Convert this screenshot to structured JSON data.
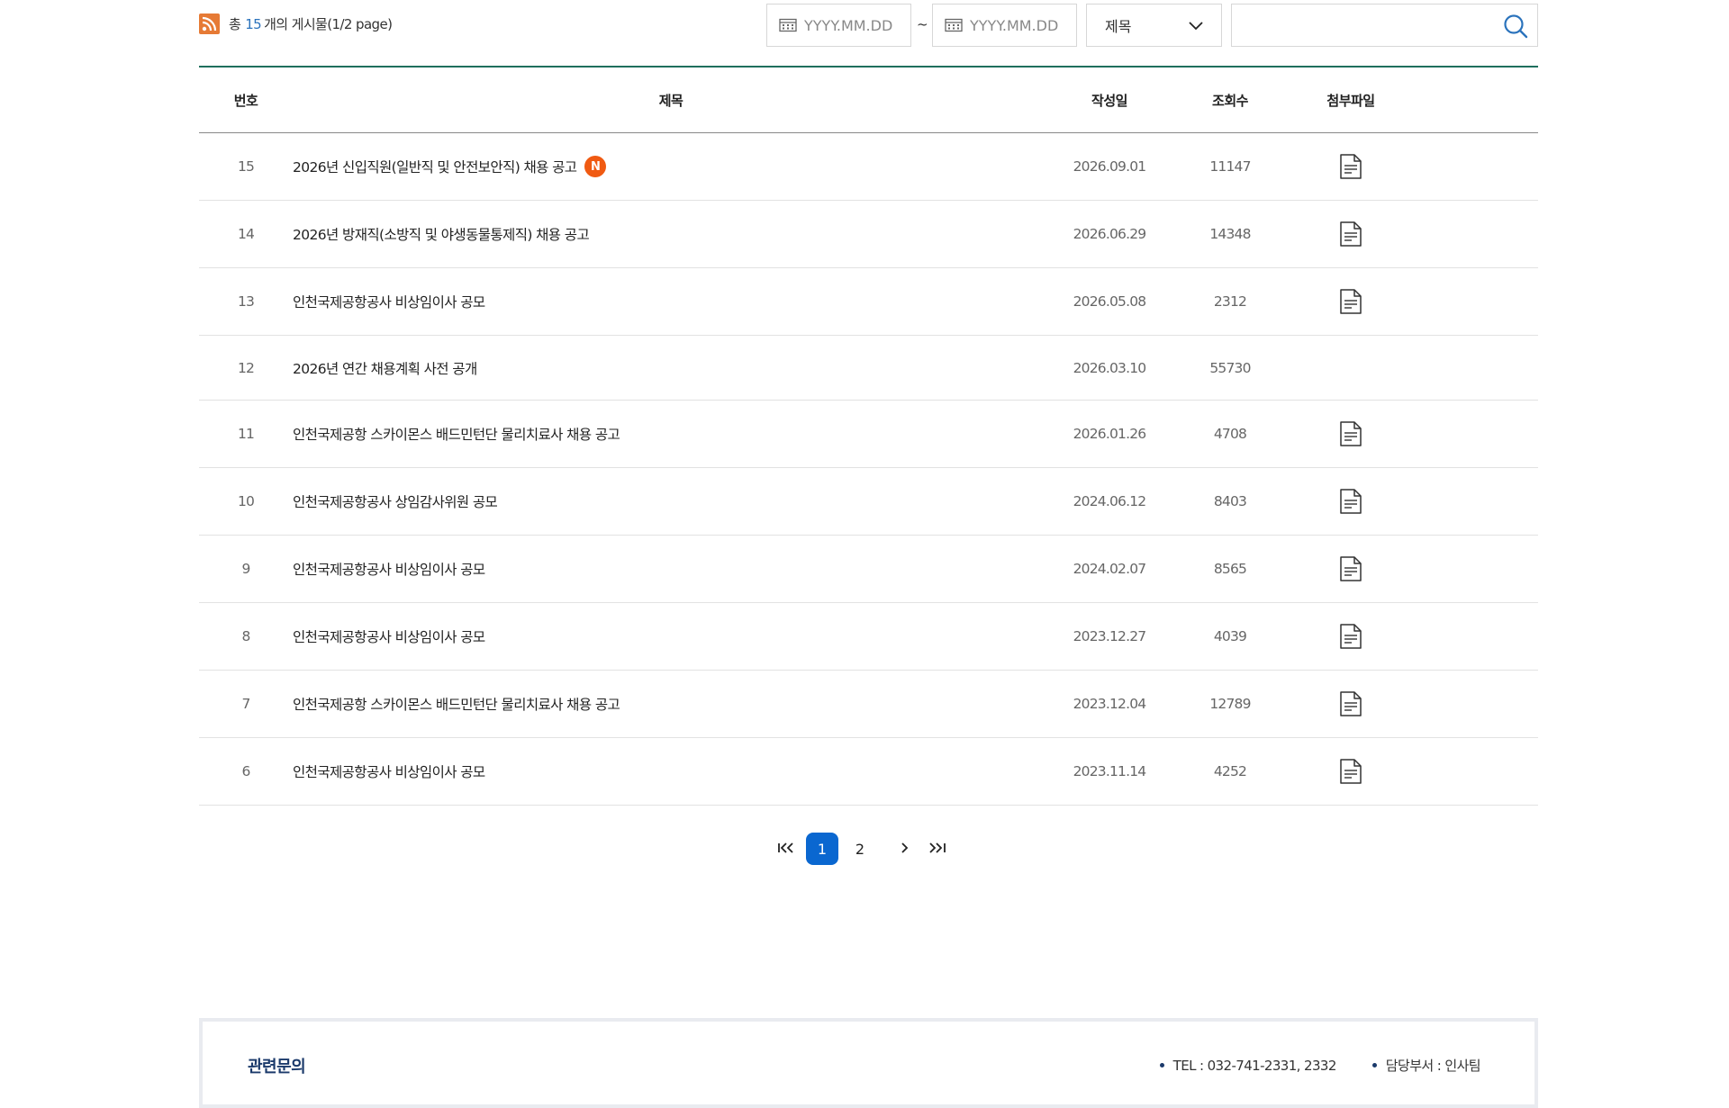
{
  "summary": {
    "prefix": "총",
    "count": "15",
    "suffix": "개의 게시물(1/2 page)"
  },
  "filters": {
    "date_from_placeholder": "YYYY.MM.DD",
    "date_separator": "~",
    "date_to_placeholder": "YYYY.MM.DD",
    "search_field_selected": "제목",
    "search_keyword_value": ""
  },
  "table": {
    "headers": {
      "number": "번호",
      "title": "제목",
      "date": "작성일",
      "views": "조회수",
      "attachment": "첨부파일"
    },
    "rows": [
      {
        "number": "15",
        "title": "2026년 신입직원(일반직 및 안전보안직) 채용 공고",
        "date": "2026.09.01",
        "views": "11147",
        "has_file": true,
        "is_new": true
      },
      {
        "number": "14",
        "title": "2026년 방재직(소방직 및 야생동물통제직) 채용 공고",
        "date": "2026.06.29",
        "views": "14348",
        "has_file": true,
        "is_new": false
      },
      {
        "number": "13",
        "title": "인천국제공항공사 비상임이사 공모",
        "date": "2026.05.08",
        "views": "2312",
        "has_file": true,
        "is_new": false
      },
      {
        "number": "12",
        "title": "2026년 연간 채용계획 사전 공개",
        "date": "2026.03.10",
        "views": "55730",
        "has_file": false,
        "is_new": false
      },
      {
        "number": "11",
        "title": "인천국제공항 스카이몬스 배드민턴단 물리치료사 채용 공고",
        "date": "2026.01.26",
        "views": "4708",
        "has_file": true,
        "is_new": false
      },
      {
        "number": "10",
        "title": "인천국제공항공사 상임감사위원 공모",
        "date": "2024.06.12",
        "views": "8403",
        "has_file": true,
        "is_new": false
      },
      {
        "number": "9",
        "title": "인천국제공항공사 비상임이사 공모",
        "date": "2024.02.07",
        "views": "8565",
        "has_file": true,
        "is_new": false
      },
      {
        "number": "8",
        "title": "인천국제공항공사 비상임이사 공모",
        "date": "2023.12.27",
        "views": "4039",
        "has_file": true,
        "is_new": false
      },
      {
        "number": "7",
        "title": "인천국제공항 스카이몬스 배드민턴단 물리치료사 채용 공고",
        "date": "2023.12.04",
        "views": "12789",
        "has_file": true,
        "is_new": false
      },
      {
        "number": "6",
        "title": "인천국제공항공사 비상임이사 공모",
        "date": "2023.11.14",
        "views": "4252",
        "has_file": true,
        "is_new": false
      }
    ],
    "new_badge": "N"
  },
  "pagination": {
    "first": "I<<",
    "pages": [
      "1",
      "2"
    ],
    "current": "1",
    "next": ">",
    "last": ">>I"
  },
  "contact": {
    "label": "관련문의",
    "tel": "TEL : 032-741-2331, 2332",
    "dept": "담당부서 : 인사팀"
  },
  "colors": {
    "accent_green": "#1f6f5d",
    "active_page": "#0a67d0",
    "new_badge": "#f05a12",
    "count_blue": "#2b73bc",
    "rss_orange": "#e67a35"
  }
}
